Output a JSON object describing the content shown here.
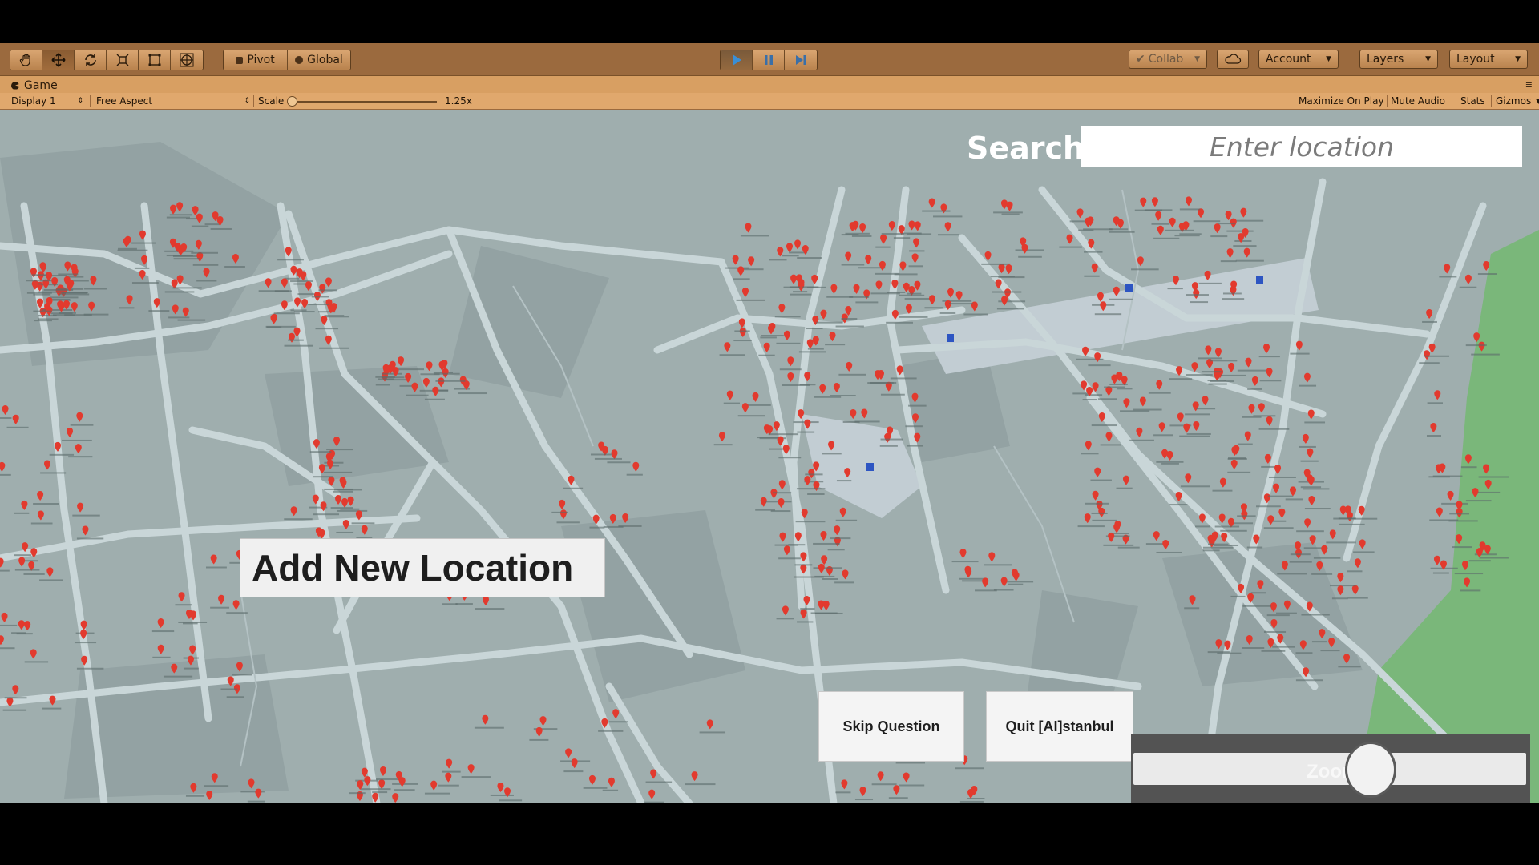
{
  "toolbar": {
    "tools": [
      "hand-tool-icon",
      "move-tool-icon",
      "rotate-tool-icon",
      "scale-tool-icon",
      "rect-tool-icon",
      "transform-tool-icon"
    ],
    "pivot_label": "Pivot",
    "global_label": "Global",
    "collab_label": "Collab",
    "account_label": "Account",
    "layers_label": "Layers",
    "layout_label": "Layout"
  },
  "game_view": {
    "tab_label": "Game",
    "display": "Display 1",
    "aspect": "Free Aspect",
    "scale_label": "Scale",
    "scale_value": "1.25x",
    "maximize_on_play": "Maximize On Play",
    "mute_audio": "Mute Audio",
    "stats": "Stats",
    "gizmos": "Gizmos"
  },
  "game_ui": {
    "search_label": "Search",
    "search_placeholder": "Enter location",
    "add_location_label": "Add New Location",
    "skip_question_label": "Skip Question",
    "quit_label": "Quit [AI]stanbul",
    "zoom_label": "Zoom +/-",
    "zoom_level": 0.62
  },
  "colors": {
    "map_background": "#9faeae",
    "road": "#c9d6d8",
    "marker": "#e23a2e",
    "park": "#7ab77a",
    "toolbar": "#9b6a3e",
    "play_active": "#3a6fa8"
  }
}
